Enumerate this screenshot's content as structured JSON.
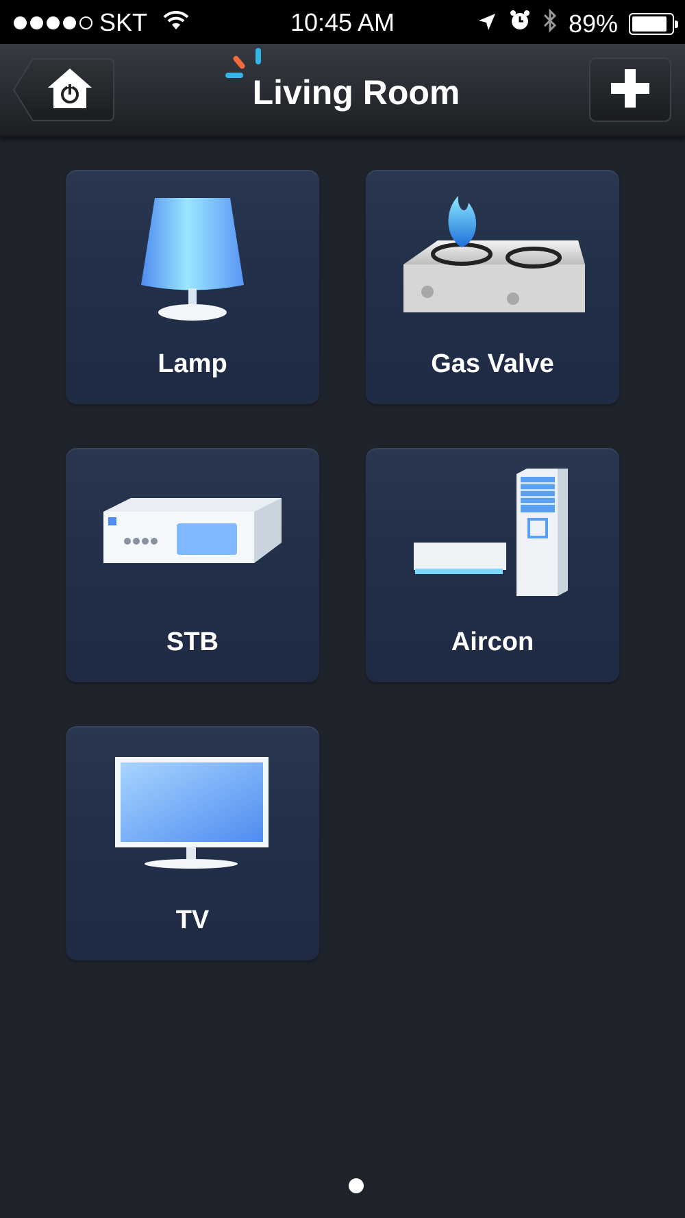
{
  "status_bar": {
    "signal_filled": 4,
    "signal_total": 5,
    "carrier": "SKT",
    "time": "10:45 AM",
    "battery_percent": "89%",
    "battery_level": 0.89,
    "icons": [
      "wifi-icon",
      "location-arrow-icon",
      "alarm-icon",
      "bluetooth-icon",
      "battery-icon"
    ]
  },
  "nav": {
    "title": "Living Room",
    "back_icon": "home-power-icon",
    "add_icon": "plus-icon"
  },
  "devices": [
    {
      "label": "Lamp",
      "icon": "lamp-icon"
    },
    {
      "label": "Gas Valve",
      "icon": "gas-stove-icon"
    },
    {
      "label": "STB",
      "icon": "set-top-box-icon"
    },
    {
      "label": "Aircon",
      "icon": "air-conditioner-icon"
    },
    {
      "label": "TV",
      "icon": "tv-icon"
    }
  ],
  "pager": {
    "current_page": 1,
    "total_pages": 1
  },
  "colors": {
    "background": "#1f232c",
    "tile": "#22304a",
    "accent_blue": "#33b5e5",
    "accent_orange": "#f26b3a"
  }
}
